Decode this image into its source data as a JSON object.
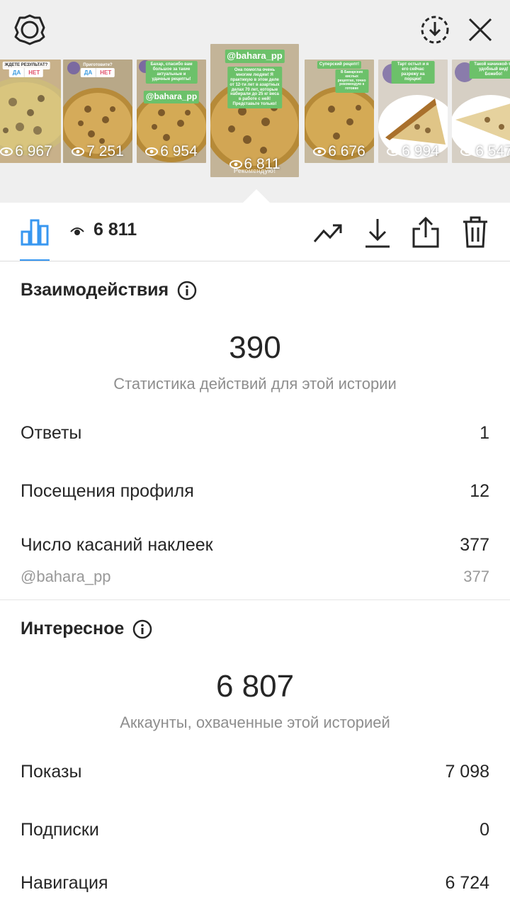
{
  "stories": [
    {
      "views": "6 967",
      "poll": {
        "question": "ЖДЕТЕ РЕЗУЛЬТАТ?",
        "yes": "ДА",
        "no": "НЕТ"
      }
    },
    {
      "views": "7 251",
      "poll": {
        "question": "Приготовите?",
        "yes": "ДА",
        "no": "НЕТ"
      }
    },
    {
      "views": "6 954",
      "mention": "@bahara_pp",
      "caption": "Бахар, спасибо вам большое за такие актуальные и удачные рецепты!"
    },
    {
      "views": "6 811",
      "mention": "@bahara_pp",
      "caption": "Она помогла очень многим людям! Я практикую в этом деле от 12-ти лет в азартных делах 70 лет, которые набирали до 25 кг веса в работе с ней! Представьте только!",
      "watermark": "Рекомендую!",
      "selected": true
    },
    {
      "views": "6 676",
      "caption": "Суперский рецепт!",
      "caption2": "В Баварских кислых рецептах, точно рекомендую к готовке"
    },
    {
      "views": "6 994",
      "caption": "Тарт остыл и я его сейчас разрежу на порции!"
    },
    {
      "views": "6 547",
      "caption": "Такой начинкой-то удобный вид! Божебо!"
    }
  ],
  "toolbar": {
    "views_count": "6 811"
  },
  "interactions": {
    "title": "Взаимодействия",
    "total": "390",
    "caption": "Статистика действий для этой истории",
    "rows": [
      {
        "label": "Ответы",
        "value": "1"
      },
      {
        "label": "Посещения профиля",
        "value": "12"
      },
      {
        "label": "Число касаний наклеек",
        "value": "377"
      }
    ],
    "sticker": {
      "label": "@bahara_pp",
      "value": "377"
    }
  },
  "discovery": {
    "title": "Интересное",
    "total": "6 807",
    "caption": "Аккаунты, охваченные этой историей",
    "rows": [
      {
        "label": "Показы",
        "value": "7 098"
      },
      {
        "label": "Подписки",
        "value": "0"
      },
      {
        "label": "Навигация",
        "value": "6 724"
      }
    ]
  },
  "colors": {
    "accent": "#3897f0",
    "sticker_green": "#6cc16a",
    "muted_text": "#8e8e8e"
  }
}
